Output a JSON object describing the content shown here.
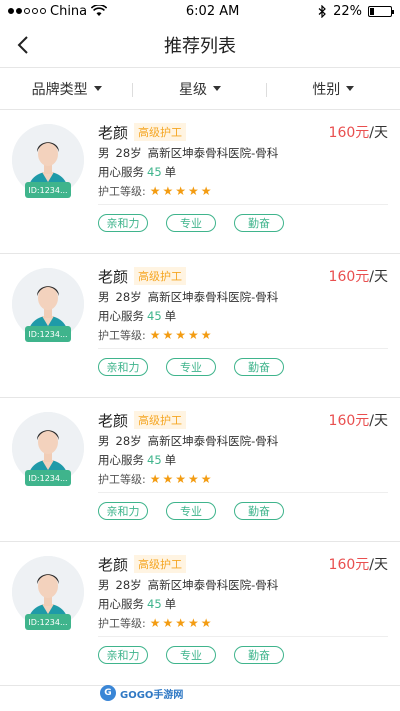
{
  "status": {
    "carrier": "China",
    "time": "6:02 AM",
    "battery": "22%",
    "battery_level": 0.22
  },
  "nav": {
    "title": "推荐列表"
  },
  "filters": [
    {
      "label": "品牌类型"
    },
    {
      "label": "星级"
    },
    {
      "label": "性别"
    }
  ],
  "caregivers": [
    {
      "name": "老颜",
      "level": "高级护工",
      "price": "160元",
      "unit": "/天",
      "gender": "男",
      "age": "28岁",
      "hospital": "高新区坤泰骨科医院-骨科",
      "service_prefix": "用心服务",
      "service_count": "45",
      "service_suffix": "单",
      "grade_label": "护工等级:",
      "stars": 5,
      "id": "ID:1234...",
      "tags": [
        "亲和力",
        "专业",
        "勤奋"
      ]
    },
    {
      "name": "老颜",
      "level": "高级护工",
      "price": "160元",
      "unit": "/天",
      "gender": "男",
      "age": "28岁",
      "hospital": "高新区坤泰骨科医院-骨科",
      "service_prefix": "用心服务",
      "service_count": "45",
      "service_suffix": "单",
      "grade_label": "护工等级:",
      "stars": 5,
      "id": "ID:1234...",
      "tags": [
        "亲和力",
        "专业",
        "勤奋"
      ]
    },
    {
      "name": "老颜",
      "level": "高级护工",
      "price": "160元",
      "unit": "/天",
      "gender": "男",
      "age": "28岁",
      "hospital": "高新区坤泰骨科医院-骨科",
      "service_prefix": "用心服务",
      "service_count": "45",
      "service_suffix": "单",
      "grade_label": "护工等级:",
      "stars": 5,
      "id": "ID:1234...",
      "tags": [
        "亲和力",
        "专业",
        "勤奋"
      ]
    },
    {
      "name": "老颜",
      "level": "高级护工",
      "price": "160元",
      "unit": "/天",
      "gender": "男",
      "age": "28岁",
      "hospital": "高新区坤泰骨科医院-骨科",
      "service_prefix": "用心服务",
      "service_count": "45",
      "service_suffix": "单",
      "grade_label": "护工等级:",
      "stars": 5,
      "id": "ID:1234...",
      "tags": [
        "亲和力",
        "专业",
        "勤奋"
      ]
    }
  ],
  "watermark": {
    "text": "GOGO手游网",
    "icon": "gogo-logo-icon"
  },
  "colors": {
    "accent": "#3fb48c",
    "price": "#e94f4f",
    "level_badge": "#f5a623",
    "star": "#f39c12"
  }
}
